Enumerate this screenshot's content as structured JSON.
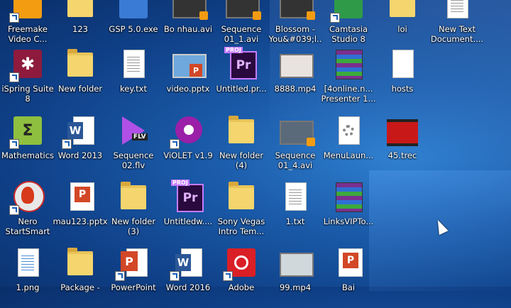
{
  "desktop": {
    "icons": [
      {
        "label": "Freemake Video C...",
        "icon": "freemake-icon"
      },
      {
        "label": "123",
        "icon": "folder-icon"
      },
      {
        "label": "GSP 5.0.exe",
        "icon": "gsp-icon"
      },
      {
        "label": "Bo nhau.avi",
        "icon": "video-icon"
      },
      {
        "label": "Sequence 01_1.avi",
        "icon": "video-icon"
      },
      {
        "label": "Blossom - You&#039;l...",
        "icon": "video-icon"
      },
      {
        "label": "Camtasia Studio 8",
        "icon": "camtasia-icon"
      },
      {
        "label": "loi",
        "icon": "folder-icon"
      },
      {
        "label": "New Text Document....",
        "icon": "text-document-icon"
      },
      {
        "label": "iSpring Suite 8",
        "icon": "ispring-icon"
      },
      {
        "label": "New folder",
        "icon": "folder-icon"
      },
      {
        "label": "key.txt",
        "icon": "text-document-icon"
      },
      {
        "label": "video.pptx",
        "icon": "pptx-icon"
      },
      {
        "label": "Untitled.pr...",
        "icon": "premiere-project-icon"
      },
      {
        "label": "8888.mp4",
        "icon": "video-icon"
      },
      {
        "label": "[4online.n... Presenter 1...",
        "icon": "winrar-icon"
      },
      {
        "label": "hosts",
        "icon": "file-icon"
      },
      {
        "label": "Mathematics",
        "icon": "mathematics-icon"
      },
      {
        "label": "Word 2013",
        "icon": "word-icon"
      },
      {
        "label": "Sequence 02.flv",
        "icon": "flv-icon"
      },
      {
        "label": "ViOLET v1.9",
        "icon": "violet-icon"
      },
      {
        "label": "New folder (4)",
        "icon": "folder-icon"
      },
      {
        "label": "Sequence 01_4.avi",
        "icon": "video-icon"
      },
      {
        "label": "MenuLaun...",
        "icon": "settings-file-icon"
      },
      {
        "label": "45.trec",
        "icon": "trec-icon"
      },
      {
        "label": "Nero StartSmart",
        "icon": "nero-icon"
      },
      {
        "label": "mau123.pptx",
        "icon": "pptx-icon"
      },
      {
        "label": "New folder (3)",
        "icon": "folder-icon"
      },
      {
        "label": "Untitledw....",
        "icon": "premiere-project-icon"
      },
      {
        "label": "Sony Vegas Intro Tem...",
        "icon": "folder-icon"
      },
      {
        "label": "1.txt",
        "icon": "text-document-icon"
      },
      {
        "label": "LinksVIPTo...",
        "icon": "winrar-icon"
      },
      {
        "label": "1.png",
        "icon": "image-icon"
      },
      {
        "label": "Package -",
        "icon": "package-icon"
      },
      {
        "label": "PowerPoint",
        "icon": "powerpoint-icon"
      },
      {
        "label": "Word 2016",
        "icon": "word-icon"
      },
      {
        "label": "Adobe",
        "icon": "adobe-cc-icon"
      },
      {
        "label": "99.mp4",
        "icon": "video-icon"
      },
      {
        "label": "Bai",
        "icon": "pptx-icon"
      }
    ],
    "badges": {
      "proj": "PROJ",
      "pr": "Pr",
      "flv": "FLV",
      "p": "P",
      "w": "W",
      "sigma": "Σ"
    }
  }
}
